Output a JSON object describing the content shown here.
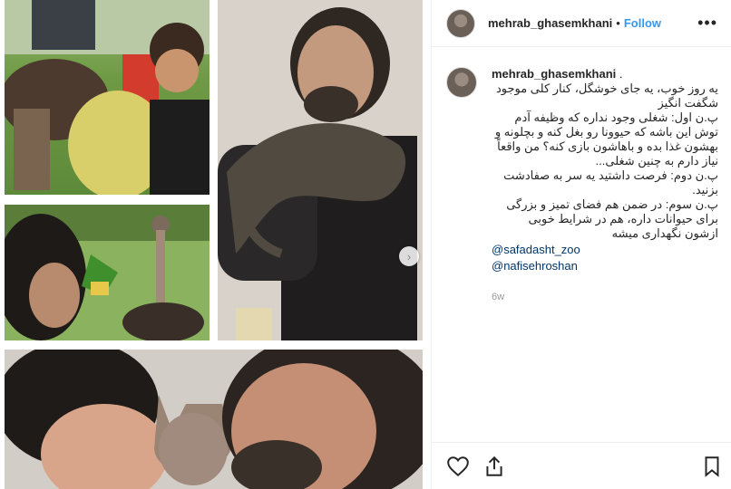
{
  "post": {
    "username": "mehrab_ghasemkhani",
    "separator": "•",
    "follow_label": "Follow",
    "more_label": "•••"
  },
  "caption": {
    "username": "mehrab_ghasemkhani",
    "suffix": " .",
    "text_lines": [
      "یه روز خوب، یه جای خوشگل، کنار کلی موجود شگفت انگیز",
      "پ.ن اول: شغلی وجود نداره که وظیفه آدم توش این باشه که حیوونا رو بغل کنه و بچلونه و بهشون غذا بده و باهاشون بازی کنه؟ من واقعاً نیاز دارم به چنین شغلی...",
      "پ.ن دوم: فرصت داشتید یه سر به صفادشت بزنید.",
      "پ.ن سوم: در ضمن هم فضای تمیز و بزرگی برای حیوانات داره، هم در شرایط خوبی ازشون نگهداری میشه"
    ],
    "mentions": [
      "@safadasht_zoo",
      "@nafisehroshan"
    ],
    "time_ago": "6w"
  },
  "media": {
    "photos": [
      {
        "name": "camel-and-boy-photo"
      },
      {
        "name": "man-with-lizard-photo"
      },
      {
        "name": "ostrich-feeding-photo"
      },
      {
        "name": "sphynx-cat-kiss-photo"
      }
    ],
    "next_icon": "chevron-right-icon"
  },
  "actions": {
    "icons": [
      "heart-icon",
      "share-icon",
      "bookmark-icon"
    ]
  }
}
